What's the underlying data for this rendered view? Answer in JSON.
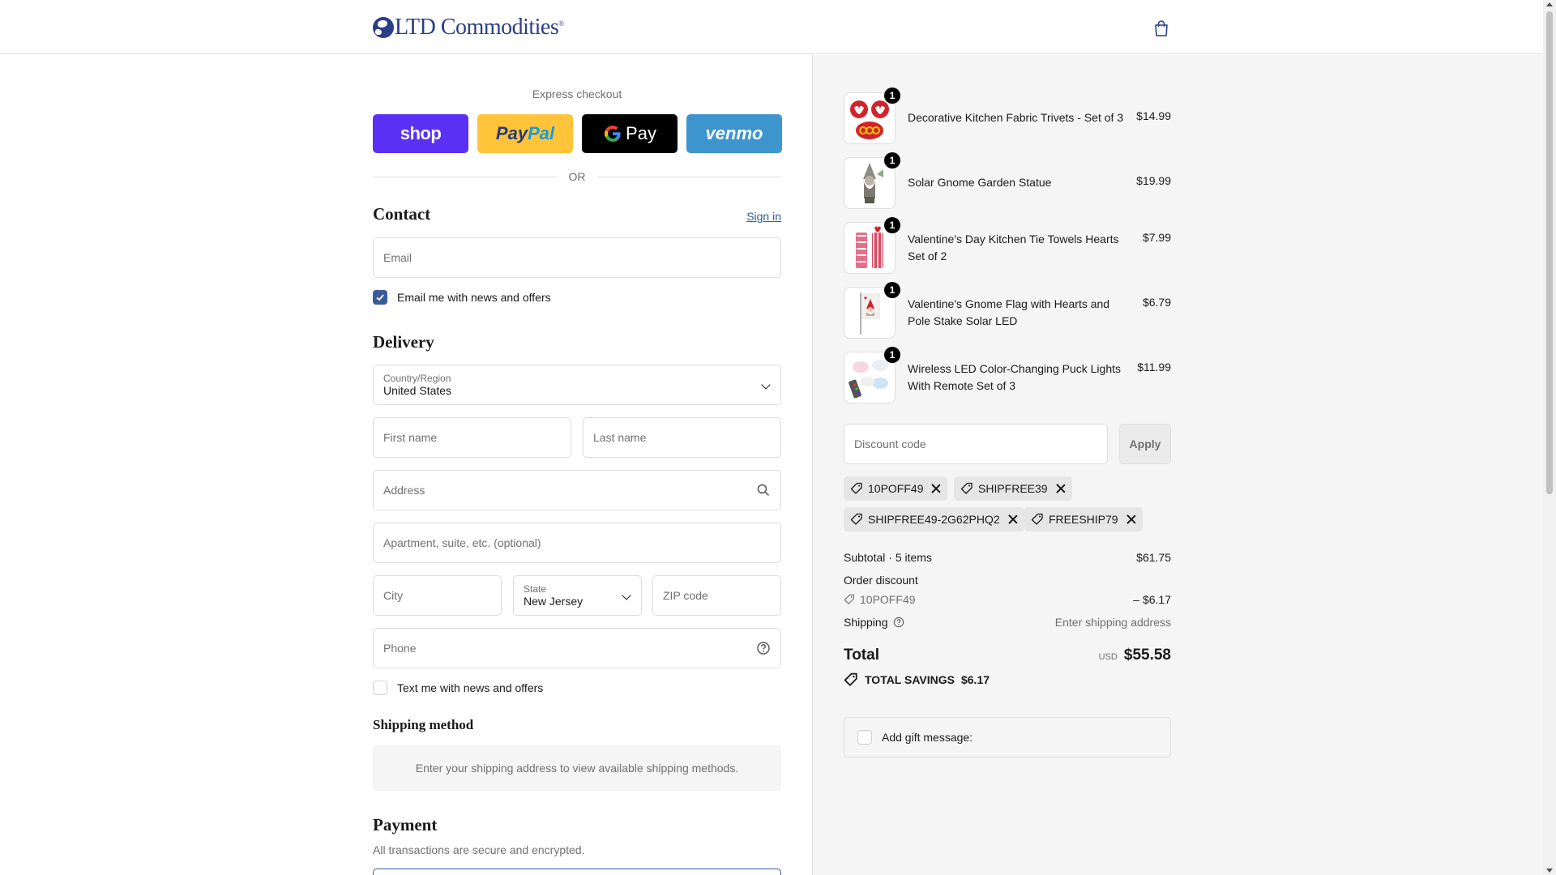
{
  "header": {
    "brand": "LTD Commodities",
    "brand_mark": "®"
  },
  "express": {
    "title": "Express checkout",
    "shop_label": "shop",
    "paypal_label_1": "Pay",
    "paypal_label_2": "Pal",
    "gpay_label": "Pay",
    "venmo_label": "venmo",
    "or_label": "OR"
  },
  "contact": {
    "title": "Contact",
    "signin_label": "Sign in",
    "email_placeholder": "Email",
    "news_label": "Email me with news and offers",
    "news_checked": true
  },
  "delivery": {
    "title": "Delivery",
    "country_label": "Country/Region",
    "country_value": "United States",
    "first_name_placeholder": "First name",
    "last_name_placeholder": "Last name",
    "address_placeholder": "Address",
    "apartment_placeholder": "Apartment, suite, etc. (optional)",
    "city_placeholder": "City",
    "state_label": "State",
    "state_value": "New Jersey",
    "zip_placeholder": "ZIP code",
    "phone_placeholder": "Phone",
    "text_label": "Text me with news and offers",
    "text_checked": false
  },
  "shipping_method": {
    "title": "Shipping method",
    "message": "Enter your shipping address to view available shipping methods."
  },
  "payment": {
    "title": "Payment",
    "subtitle": "All transactions are secure and encrypted."
  },
  "cart": {
    "items": [
      {
        "name": "Decorative Kitchen Fabric Trivets - Set of 3",
        "price": "$14.99",
        "qty": "1"
      },
      {
        "name": "Solar Gnome Garden Statue",
        "price": "$19.99",
        "qty": "1"
      },
      {
        "name": "Valentine's Day Kitchen Tie Towels Hearts Set of 2",
        "price": "$7.99",
        "qty": "1"
      },
      {
        "name": "Valentine's Gnome Flag with Hearts and Pole Stake Solar LED",
        "price": "$6.79",
        "qty": "1"
      },
      {
        "name": "Wireless LED Color-Changing Puck Lights With Remote Set of 3",
        "price": "$11.99",
        "qty": "1"
      }
    ],
    "discount_placeholder": "Discount code",
    "apply_label": "Apply",
    "codes": [
      "10POFF49",
      "SHIPFREE39",
      "SHIPFREE49-2G62PHQ2",
      "FREESHIP79"
    ]
  },
  "totals": {
    "subtotal_label": "Subtotal · 5 items",
    "subtotal_value": "$61.75",
    "order_discount_label": "Order discount",
    "discount_code": "10POFF49",
    "discount_value": "– $6.17",
    "shipping_label": "Shipping",
    "shipping_value": "Enter shipping address",
    "total_label": "Total",
    "currency": "USD",
    "total_value": "$55.58",
    "savings_label": "TOTAL SAVINGS",
    "savings_value": "$6.17"
  },
  "gift": {
    "label": "Add gift message:"
  },
  "colors": {
    "brand": "#2b3f86",
    "shop": "#5a31f4",
    "paypal": "#ffc439",
    "venmo": "#3d95ce",
    "link": "#2b5fa8"
  }
}
